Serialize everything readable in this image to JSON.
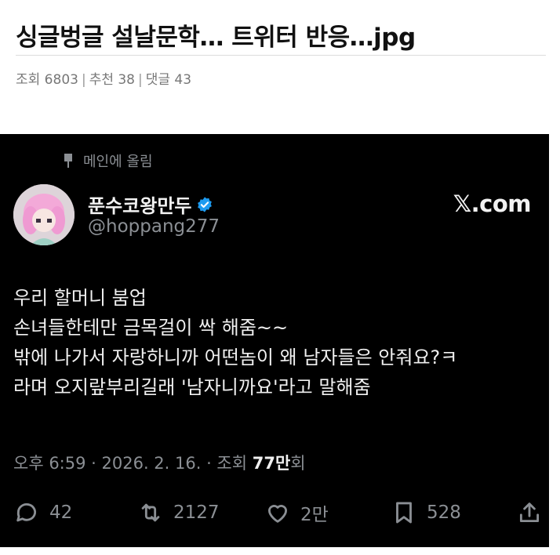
{
  "post": {
    "title": "싱글벙글 설날문학… 트위터 반응…jpg",
    "meta": {
      "views": "조회 6803",
      "recommends": "추천 38",
      "comments": "댓글 43",
      "separator": "|"
    }
  },
  "tweet": {
    "pinned_label": "메인에 올림",
    "display_name": "푼수코왕만두",
    "handle": "@hoppang277",
    "site": "𝕏.com",
    "lines": [
      "우리 할머니 붐업",
      "손녀들한테만 금목걸이 싹 해줌~~",
      "밖에 나가서 자랑하니까 어떤놈이 왜 남자들은 안줘요?ㅋ",
      "라며 오지랖부리길래 '남자니까요'라고 말해줌"
    ],
    "timestamp": "오후 6:59 · 2026. 2. 16. · 조회 ",
    "views_count": "77만",
    "views_suffix": "회",
    "actions": {
      "replies": "42",
      "retweets": "2127",
      "likes": "2만",
      "bookmarks": "528"
    },
    "colors": {
      "background": "#000000",
      "verified": "#1d9bf0",
      "muted": "#8b8f94"
    },
    "icons": [
      "pin-icon",
      "verified-icon",
      "reply-icon",
      "retweet-icon",
      "like-icon",
      "bookmark-icon",
      "share-icon"
    ]
  }
}
